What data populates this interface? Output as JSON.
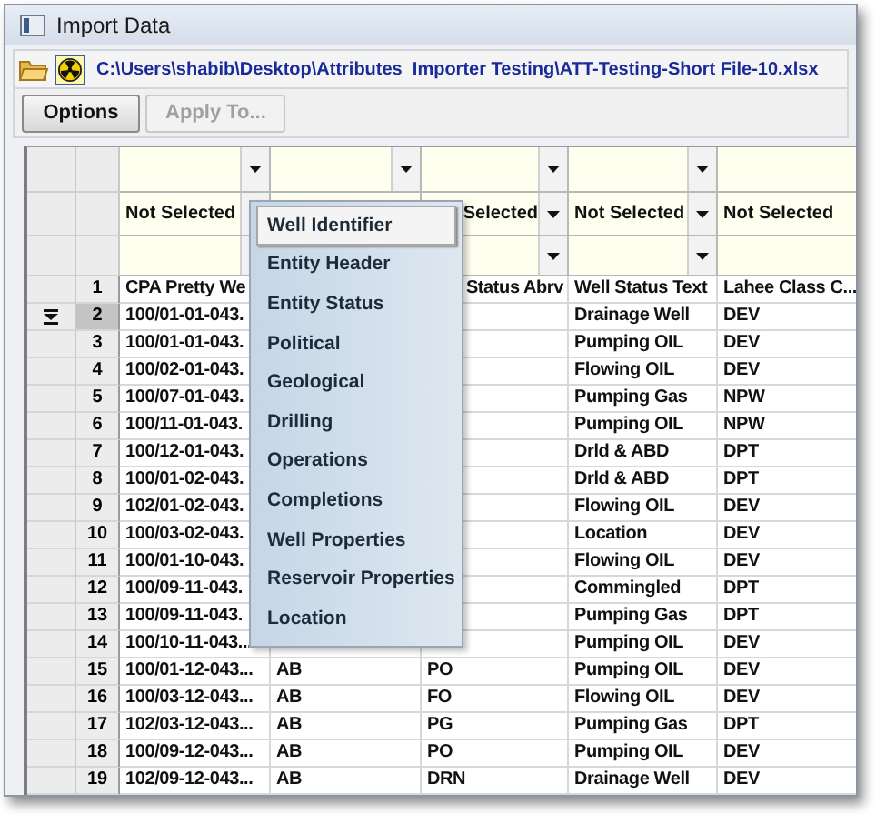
{
  "window": {
    "title": "Import Data"
  },
  "path_bar": {
    "path": "C:\\Users\\shabib\\Desktop\\Attributes  Importer Testing\\ATT-Testing-Short File-10.xlsx"
  },
  "toolbar": [
    {
      "label": "Options",
      "disabled": false
    },
    {
      "label": "Apply To...",
      "disabled": true
    }
  ],
  "mapping_rows": [
    {
      "kind": "empty",
      "cells": [
        "",
        "",
        "",
        "",
        ""
      ]
    },
    {
      "kind": "choice",
      "cells": [
        "Not Selected",
        null,
        "Selected",
        "Not Selected",
        "Not Selected"
      ]
    },
    {
      "kind": "empty",
      "cells": [
        "",
        null,
        "",
        "",
        ""
      ]
    }
  ],
  "rows": [
    {
      "number": "1",
      "selected": false,
      "cells": [
        "CPA Pretty We",
        null,
        "Status Abrv",
        "Well Status Text",
        "Lahee Class C..."
      ]
    },
    {
      "number": "2",
      "selected": true,
      "cells": [
        "100/01-01-043.",
        null,
        null,
        "Drainage Well",
        "DEV"
      ]
    },
    {
      "number": "3",
      "selected": false,
      "cells": [
        "100/01-01-043.",
        null,
        null,
        "Pumping OIL",
        "DEV"
      ]
    },
    {
      "number": "4",
      "selected": false,
      "cells": [
        "100/02-01-043.",
        null,
        null,
        "Flowing OIL",
        "DEV"
      ]
    },
    {
      "number": "5",
      "selected": false,
      "cells": [
        "100/07-01-043.",
        null,
        null,
        "Pumping Gas",
        "NPW"
      ]
    },
    {
      "number": "6",
      "selected": false,
      "cells": [
        "100/11-01-043.",
        null,
        null,
        "Pumping OIL",
        "NPW"
      ]
    },
    {
      "number": "7",
      "selected": false,
      "cells": [
        "100/12-01-043.",
        null,
        null,
        "Drld & ABD",
        "DPT"
      ]
    },
    {
      "number": "8",
      "selected": false,
      "cells": [
        "100/01-02-043.",
        null,
        null,
        "Drld & ABD",
        "DPT"
      ]
    },
    {
      "number": "9",
      "selected": false,
      "cells": [
        "102/01-02-043.",
        null,
        null,
        "Flowing OIL",
        "DEV"
      ]
    },
    {
      "number": "10",
      "selected": false,
      "cells": [
        "100/03-02-043.",
        null,
        null,
        "Location",
        "DEV"
      ]
    },
    {
      "number": "11",
      "selected": false,
      "cells": [
        "100/01-10-043.",
        null,
        null,
        "Flowing OIL",
        "DEV"
      ]
    },
    {
      "number": "12",
      "selected": false,
      "cells": [
        "100/09-11-043.",
        null,
        null,
        "Commingled",
        "DPT"
      ]
    },
    {
      "number": "13",
      "selected": false,
      "cells": [
        "100/09-11-043.",
        null,
        null,
        "Pumping Gas",
        "DPT"
      ]
    },
    {
      "number": "14",
      "selected": false,
      "cells": [
        "100/10-11-043...",
        null,
        null,
        "Pumping OIL",
        "DEV"
      ]
    },
    {
      "number": "15",
      "selected": false,
      "cells": [
        "100/01-12-043...",
        "AB",
        "PO",
        "Pumping OIL",
        "DEV"
      ]
    },
    {
      "number": "16",
      "selected": false,
      "cells": [
        "100/03-12-043...",
        "AB",
        "FO",
        "Flowing OIL",
        "DEV"
      ]
    },
    {
      "number": "17",
      "selected": false,
      "cells": [
        "102/03-12-043...",
        "AB",
        "PG",
        "Pumping Gas",
        "DPT"
      ]
    },
    {
      "number": "18",
      "selected": false,
      "cells": [
        "100/09-12-043...",
        "AB",
        "PO",
        "Pumping OIL",
        "DEV"
      ]
    },
    {
      "number": "19",
      "selected": false,
      "cells": [
        "102/09-12-043...",
        "AB",
        "DRN",
        "Drainage Well",
        "DEV"
      ]
    }
  ],
  "menu": {
    "items": [
      {
        "label": "Well Identifier",
        "selected": true
      },
      {
        "label": "Entity Header",
        "selected": false
      },
      {
        "label": "Entity Status",
        "selected": false
      },
      {
        "label": "Political",
        "selected": false
      },
      {
        "label": "Geological",
        "selected": false
      },
      {
        "label": "Drilling",
        "selected": false
      },
      {
        "label": "Operations",
        "selected": false
      },
      {
        "label": "Completions",
        "selected": false
      },
      {
        "label": "Well Properties",
        "selected": false
      },
      {
        "label": "Reservoir Properties",
        "selected": false
      },
      {
        "label": "Location",
        "selected": false
      }
    ]
  }
}
